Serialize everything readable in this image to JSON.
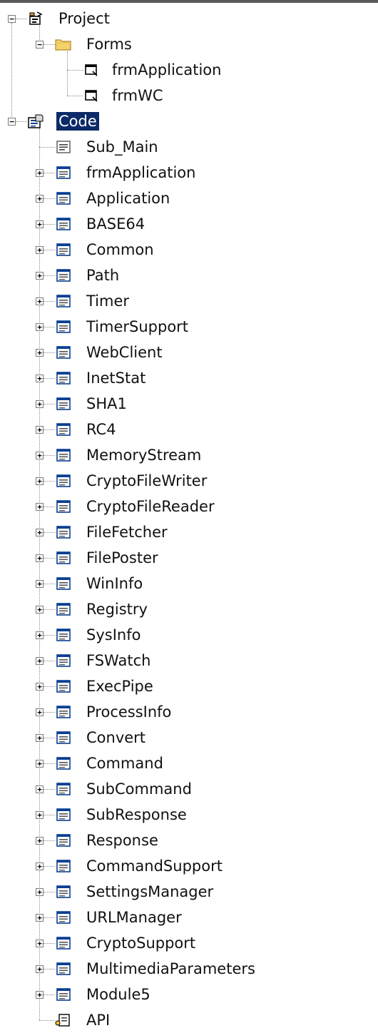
{
  "tree": {
    "project": {
      "label": "Project",
      "icon": "project-icon",
      "expanded": true
    },
    "forms": {
      "label": "Forms",
      "icon": "folder-icon",
      "expanded": true,
      "items": [
        {
          "label": "frmApplication",
          "icon": "form-icon"
        },
        {
          "label": "frmWC",
          "icon": "form-icon"
        }
      ]
    },
    "code": {
      "label": "Code",
      "icon": "code-group-icon",
      "expanded": true,
      "selected": true,
      "items": [
        {
          "label": "Sub_Main",
          "icon": "module-icon",
          "expandable": false
        },
        {
          "label": "frmApplication",
          "icon": "class-icon",
          "expandable": true
        },
        {
          "label": "Application",
          "icon": "class-icon",
          "expandable": true
        },
        {
          "label": "BASE64",
          "icon": "class-icon",
          "expandable": true
        },
        {
          "label": "Common",
          "icon": "class-icon",
          "expandable": true
        },
        {
          "label": "Path",
          "icon": "class-icon",
          "expandable": true
        },
        {
          "label": "Timer",
          "icon": "class-icon",
          "expandable": true
        },
        {
          "label": "TimerSupport",
          "icon": "class-icon",
          "expandable": true
        },
        {
          "label": "WebClient",
          "icon": "class-icon",
          "expandable": true
        },
        {
          "label": "InetStat",
          "icon": "class-icon",
          "expandable": true
        },
        {
          "label": "SHA1",
          "icon": "class-icon",
          "expandable": true
        },
        {
          "label": "RC4",
          "icon": "class-icon",
          "expandable": true
        },
        {
          "label": "MemoryStream",
          "icon": "class-icon",
          "expandable": true
        },
        {
          "label": "CryptoFileWriter",
          "icon": "class-icon",
          "expandable": true
        },
        {
          "label": "CryptoFileReader",
          "icon": "class-icon",
          "expandable": true
        },
        {
          "label": "FileFetcher",
          "icon": "class-icon",
          "expandable": true
        },
        {
          "label": "FilePoster",
          "icon": "class-icon",
          "expandable": true
        },
        {
          "label": "WinInfo",
          "icon": "class-icon",
          "expandable": true
        },
        {
          "label": "Registry",
          "icon": "class-icon",
          "expandable": true
        },
        {
          "label": "SysInfo",
          "icon": "class-icon",
          "expandable": true
        },
        {
          "label": "FSWatch",
          "icon": "class-icon",
          "expandable": true
        },
        {
          "label": "ExecPipe",
          "icon": "class-icon",
          "expandable": true
        },
        {
          "label": "ProcessInfo",
          "icon": "class-icon",
          "expandable": true
        },
        {
          "label": "Convert",
          "icon": "class-icon",
          "expandable": true
        },
        {
          "label": "Command",
          "icon": "class-icon",
          "expandable": true
        },
        {
          "label": "SubCommand",
          "icon": "class-icon",
          "expandable": true
        },
        {
          "label": "SubResponse",
          "icon": "class-icon",
          "expandable": true
        },
        {
          "label": "Response",
          "icon": "class-icon",
          "expandable": true
        },
        {
          "label": "CommandSupport",
          "icon": "class-icon",
          "expandable": true
        },
        {
          "label": "SettingsManager",
          "icon": "class-icon",
          "expandable": true
        },
        {
          "label": "URLManager",
          "icon": "class-icon",
          "expandable": true
        },
        {
          "label": "CryptoSupport",
          "icon": "class-icon",
          "expandable": true
        },
        {
          "label": "MultimediaParameters",
          "icon": "class-icon",
          "expandable": true
        },
        {
          "label": "Module5",
          "icon": "class-icon",
          "expandable": true
        },
        {
          "label": "API",
          "icon": "interface-icon",
          "expandable": false
        }
      ]
    }
  },
  "colors": {
    "selection": "#0b2a67",
    "tree_lines": "#8a8a8a",
    "class_icon": "#0a3f93"
  }
}
